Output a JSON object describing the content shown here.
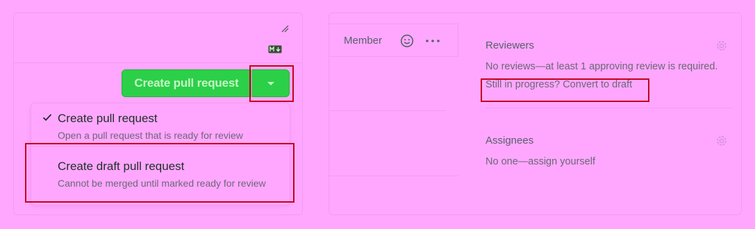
{
  "compose": {
    "create_button_label": "Create pull request",
    "dropdown": {
      "items": [
        {
          "title": "Create pull request",
          "description": "Open a pull request that is ready for review",
          "selected": true
        },
        {
          "title": "Create draft pull request",
          "description": "Cannot be merged until marked ready for review",
          "selected": false
        }
      ]
    }
  },
  "comment": {
    "role_badge": "Member"
  },
  "sidebar": {
    "reviewers": {
      "heading": "Reviewers",
      "status": "No reviews—at least 1 approving review is required.",
      "draft_link": "Still in progress? Convert to draft"
    },
    "assignees": {
      "heading": "Assignees",
      "status": "No one—assign yourself"
    }
  },
  "icons": {
    "resize": "resize-handle-icon",
    "markdown": "markdown-icon",
    "caret": "triangle-down-icon",
    "check": "check-icon",
    "smiley": "smiley-icon",
    "kebab": "kebab-horizontal-icon",
    "gear": "gear-icon"
  },
  "colors": {
    "background": "#ffa7ff",
    "button_green": "#2bd048",
    "button_text": "#c5f4c5",
    "highlight_red": "#c4001c",
    "link_text": "#6b6875"
  }
}
